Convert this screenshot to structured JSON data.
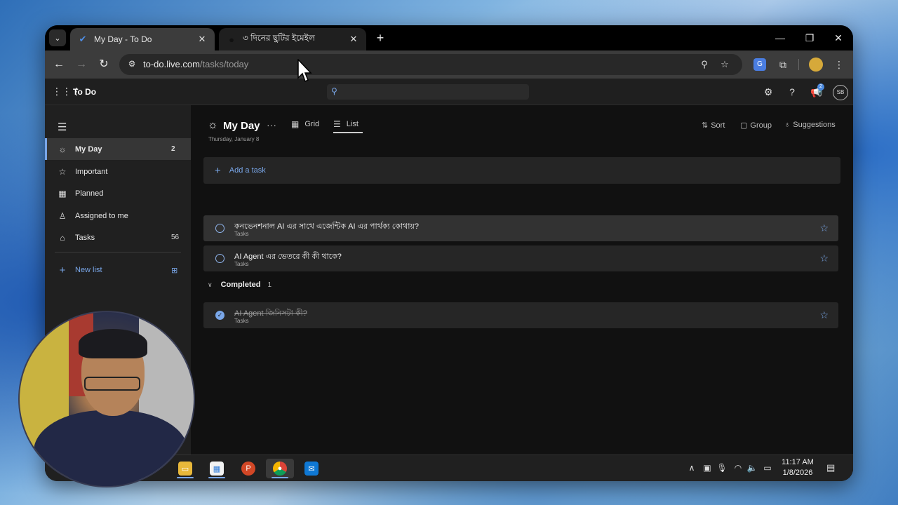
{
  "browser": {
    "tabs": [
      {
        "title": "My Day - To Do",
        "active": true
      },
      {
        "title": "৩ দিনের ছুটির ইমেইল",
        "active": false
      }
    ],
    "url_host": "to-do.live.com",
    "url_path": "/tasks/today"
  },
  "app": {
    "name": "To Do",
    "notification_count": "2",
    "user_initials": "SB"
  },
  "sidebar": {
    "items": [
      {
        "label": "My Day",
        "count": "2",
        "icon": "sun-icon",
        "selected": true
      },
      {
        "label": "Important",
        "count": "",
        "icon": "star-icon"
      },
      {
        "label": "Planned",
        "count": "",
        "icon": "calendar-icon"
      },
      {
        "label": "Assigned to me",
        "count": "",
        "icon": "person-icon"
      },
      {
        "label": "Tasks",
        "count": "56",
        "icon": "home-icon"
      }
    ],
    "new_list": "New list"
  },
  "main": {
    "title": "My Day",
    "date": "Thursday, January 8",
    "views": {
      "grid": "Grid",
      "list": "List"
    },
    "sort": "Sort",
    "group": "Group",
    "suggestions": "Suggestions",
    "add_task": "Add a task",
    "tasks": [
      {
        "title": "কনভেনশনাল AI এর সাথে এজেন্টিক AI এর পার্থক্য কোথায়?",
        "list": "Tasks",
        "completed": false
      },
      {
        "title": "AI Agent এর ভেতরে কী কী থাকে?",
        "list": "Tasks",
        "completed": false
      }
    ],
    "completed_label": "Completed",
    "completed_count": "1",
    "completed_tasks": [
      {
        "title": "AI Agent জিনিসটা কী?",
        "list": "Tasks",
        "completed": true
      }
    ]
  },
  "taskbar": {
    "time": "11:17 AM",
    "date": "1/8/2026"
  },
  "colors": {
    "accent": "#79a6e8",
    "sidebar_bg": "#202020",
    "main_bg": "#111111",
    "task_bg": "#262626"
  }
}
